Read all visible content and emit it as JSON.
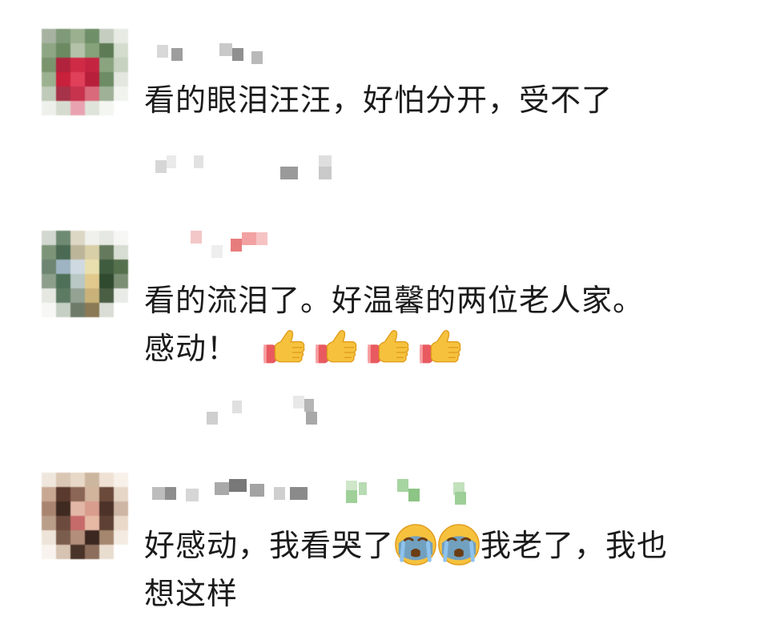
{
  "comments": [
    {
      "text_line1": "看的眼泪汪汪，好怕分开，受不了",
      "text_line2": ""
    },
    {
      "text_line1": "看的流泪了。好温馨的两位老人家。",
      "text_line2_prefix": "感动！",
      "emojis": [
        "thumbs-up",
        "thumbs-up",
        "thumbs-up",
        "thumbs-up"
      ]
    },
    {
      "text_line1_part1": "好感动，我看哭了",
      "text_line1_part2": "我老了，我也",
      "text_line2": "想这样",
      "emojis": [
        "crying-face",
        "crying-face"
      ]
    }
  ],
  "colors": {
    "text": "#1b1b1b",
    "background": "#ffffff",
    "thumb_yellow": "#f6c23e",
    "sleeve_red": "#e85a5f",
    "cry_blue": "#5a9ad6"
  }
}
